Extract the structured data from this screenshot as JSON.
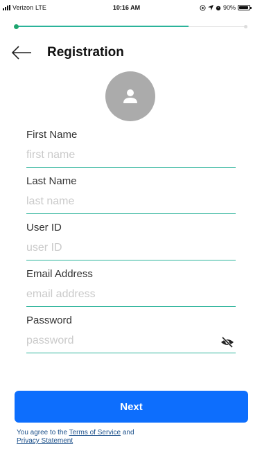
{
  "status_bar": {
    "carrier": "Verizon",
    "network": "LTE",
    "time": "10:16 AM",
    "battery": "90%",
    "battery_level": 0.9,
    "icons": [
      "signal-icon",
      "at-icon",
      "location-arrow-icon",
      "alarm-icon",
      "battery-icon"
    ]
  },
  "progress": {
    "fraction": 0.75
  },
  "header": {
    "title": "Registration",
    "back_icon": "back-arrow-icon"
  },
  "avatar": {
    "icon": "person-icon",
    "color": "#ababab"
  },
  "form": {
    "fields": [
      {
        "label": "First Name",
        "placeholder": "first name",
        "value": ""
      },
      {
        "label": "Last Name",
        "placeholder": "last name",
        "value": ""
      },
      {
        "label": "User ID",
        "placeholder": "user ID",
        "value": ""
      },
      {
        "label": "Email Address",
        "placeholder": "email address",
        "value": ""
      },
      {
        "label": "Password",
        "placeholder": "password",
        "value": "",
        "toggle_icon": "eye-slash-icon"
      }
    ]
  },
  "next_button": {
    "label": "Next",
    "color": "#0d6efd"
  },
  "terms": {
    "prefix": "You agree to the ",
    "terms_link": "Terms of Service",
    "conjunction": " and",
    "privacy_link": "Privacy Statement"
  },
  "colors": {
    "accent": "#2bb39a",
    "progress_start": "#1fa56f",
    "primary": "#0d6efd",
    "link": "#1a4f8a"
  }
}
